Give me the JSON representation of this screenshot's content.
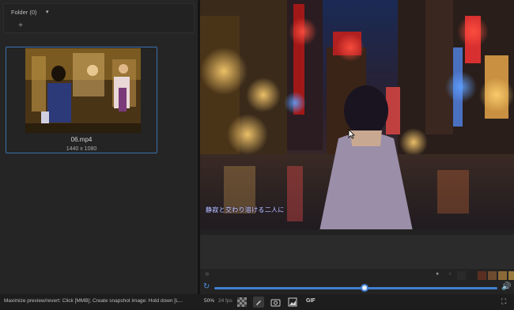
{
  "sidebar": {
    "folder_label": "Folder (0)",
    "folder_caret": "▾",
    "add_glyph": "+",
    "items": [
      {
        "filename": "06.mp4",
        "resolution": "1440 x 1080"
      }
    ]
  },
  "preview": {
    "subtitle": "静寂と交わり溶ける二人に"
  },
  "palette": {
    "swatches": [
      "#2a2a2a",
      "#222222",
      "#5a2f22",
      "#6e4a2f",
      "#8c6a38",
      "#9a7a3c"
    ]
  },
  "playback": {
    "progress": 0.53
  },
  "status": {
    "hint": "Maximize preview/revert: Click [MMB]; Create snapshot image: Hold down [L...",
    "zoom": "50%",
    "fps": "24 fps",
    "gif_label": "GIF"
  },
  "colors": {
    "accent": "#3f7fd0",
    "panel_bg": "#252525",
    "selection_border": "#3b6fb0"
  }
}
